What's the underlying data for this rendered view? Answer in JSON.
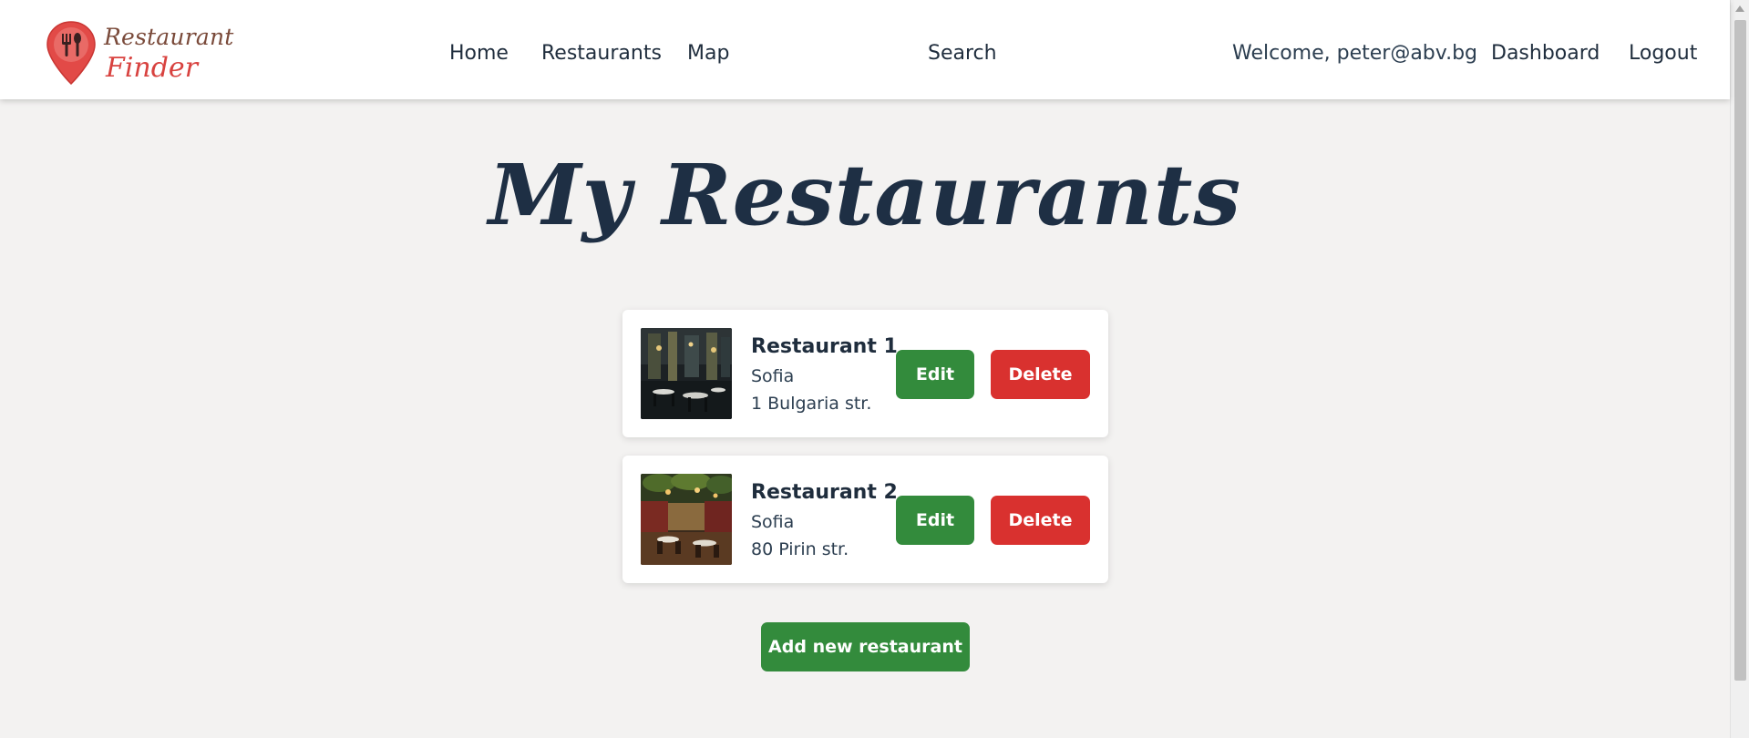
{
  "brand": {
    "line1": "Restaurant",
    "line2": "Finder"
  },
  "nav": {
    "left": [
      "Home",
      "Restaurants",
      "Map"
    ],
    "center": "Search",
    "welcome": "Welcome, peter@abv.bg",
    "right": [
      "Dashboard",
      "Logout"
    ]
  },
  "page": {
    "title": "My Restaurants"
  },
  "restaurants": [
    {
      "name": "Restaurant 1",
      "city": "Sofia",
      "address": "1 Bulgaria str."
    },
    {
      "name": "Restaurant 2",
      "city": "Sofia",
      "address": "80 Pirin str."
    }
  ],
  "actions": {
    "edit": "Edit",
    "delete": "Delete",
    "add": "Add new restaurant"
  },
  "colors": {
    "accent_green": "#338b3c",
    "danger_red": "#d9312f",
    "brand_red": "#d8423f",
    "text_dark": "#1f2d3d"
  }
}
